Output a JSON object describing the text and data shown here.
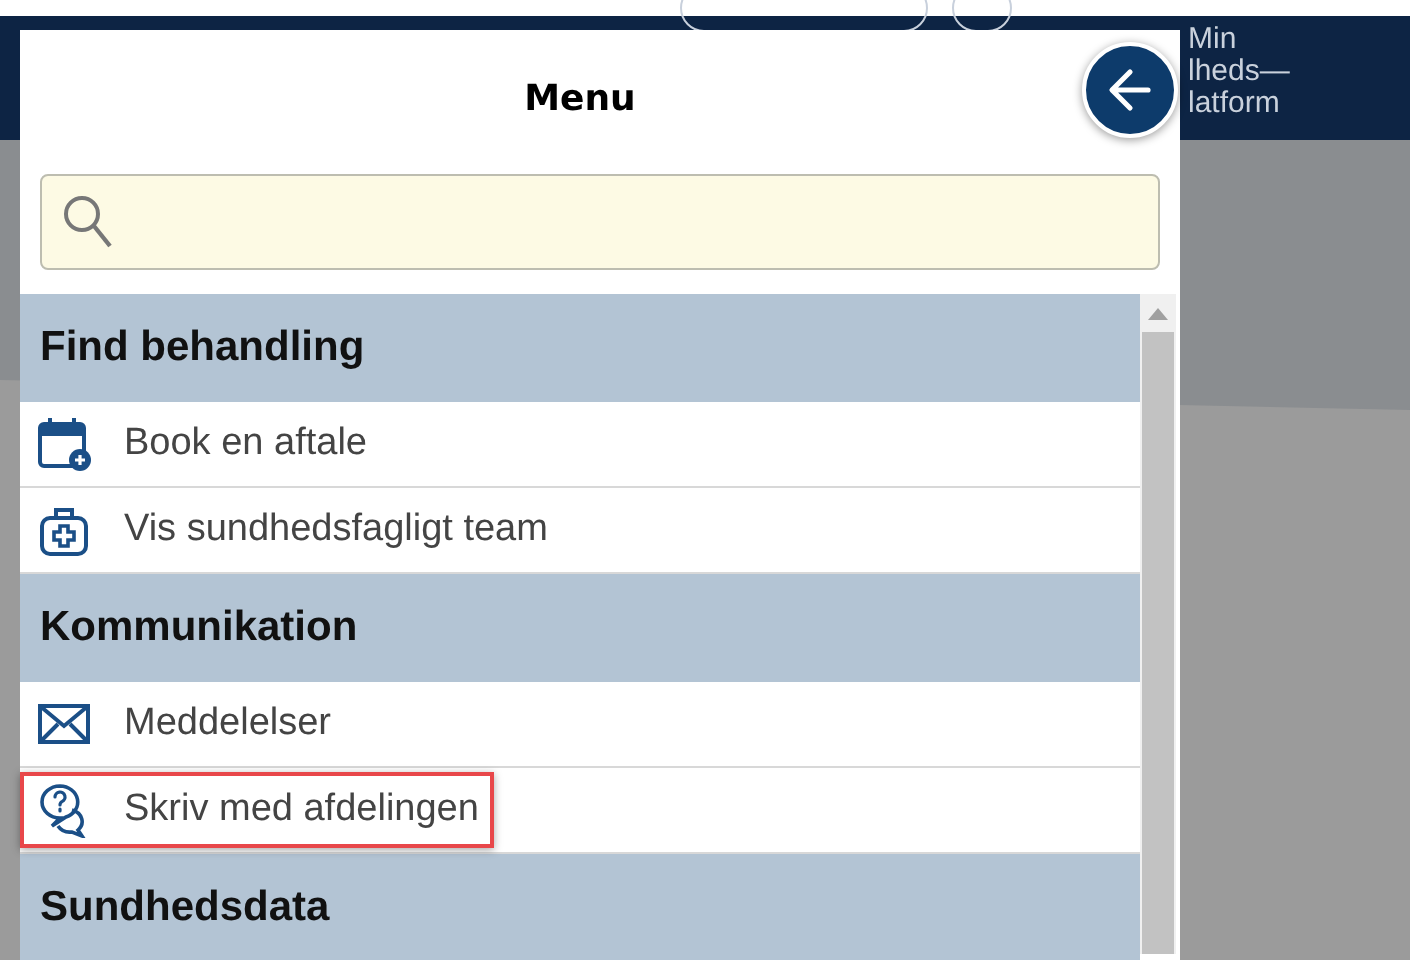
{
  "header": {
    "logo_lines": [
      "Min",
      "lheds—",
      "latform"
    ]
  },
  "menu": {
    "title": "Menu",
    "sections": [
      {
        "title": "Find behandling",
        "items": [
          {
            "label": "Book en aftale",
            "kind": "calendar",
            "highlighted": false
          },
          {
            "label": "Vis sundhedsfagligt team",
            "kind": "medkit",
            "highlighted": false
          }
        ]
      },
      {
        "title": "Kommunikation",
        "items": [
          {
            "label": "Meddelelser",
            "kind": "mail",
            "highlighted": false
          },
          {
            "label": "Skriv med afdelingen",
            "kind": "chat",
            "highlighted": true
          }
        ]
      },
      {
        "title": "Sundhedsdata"
      }
    ]
  }
}
